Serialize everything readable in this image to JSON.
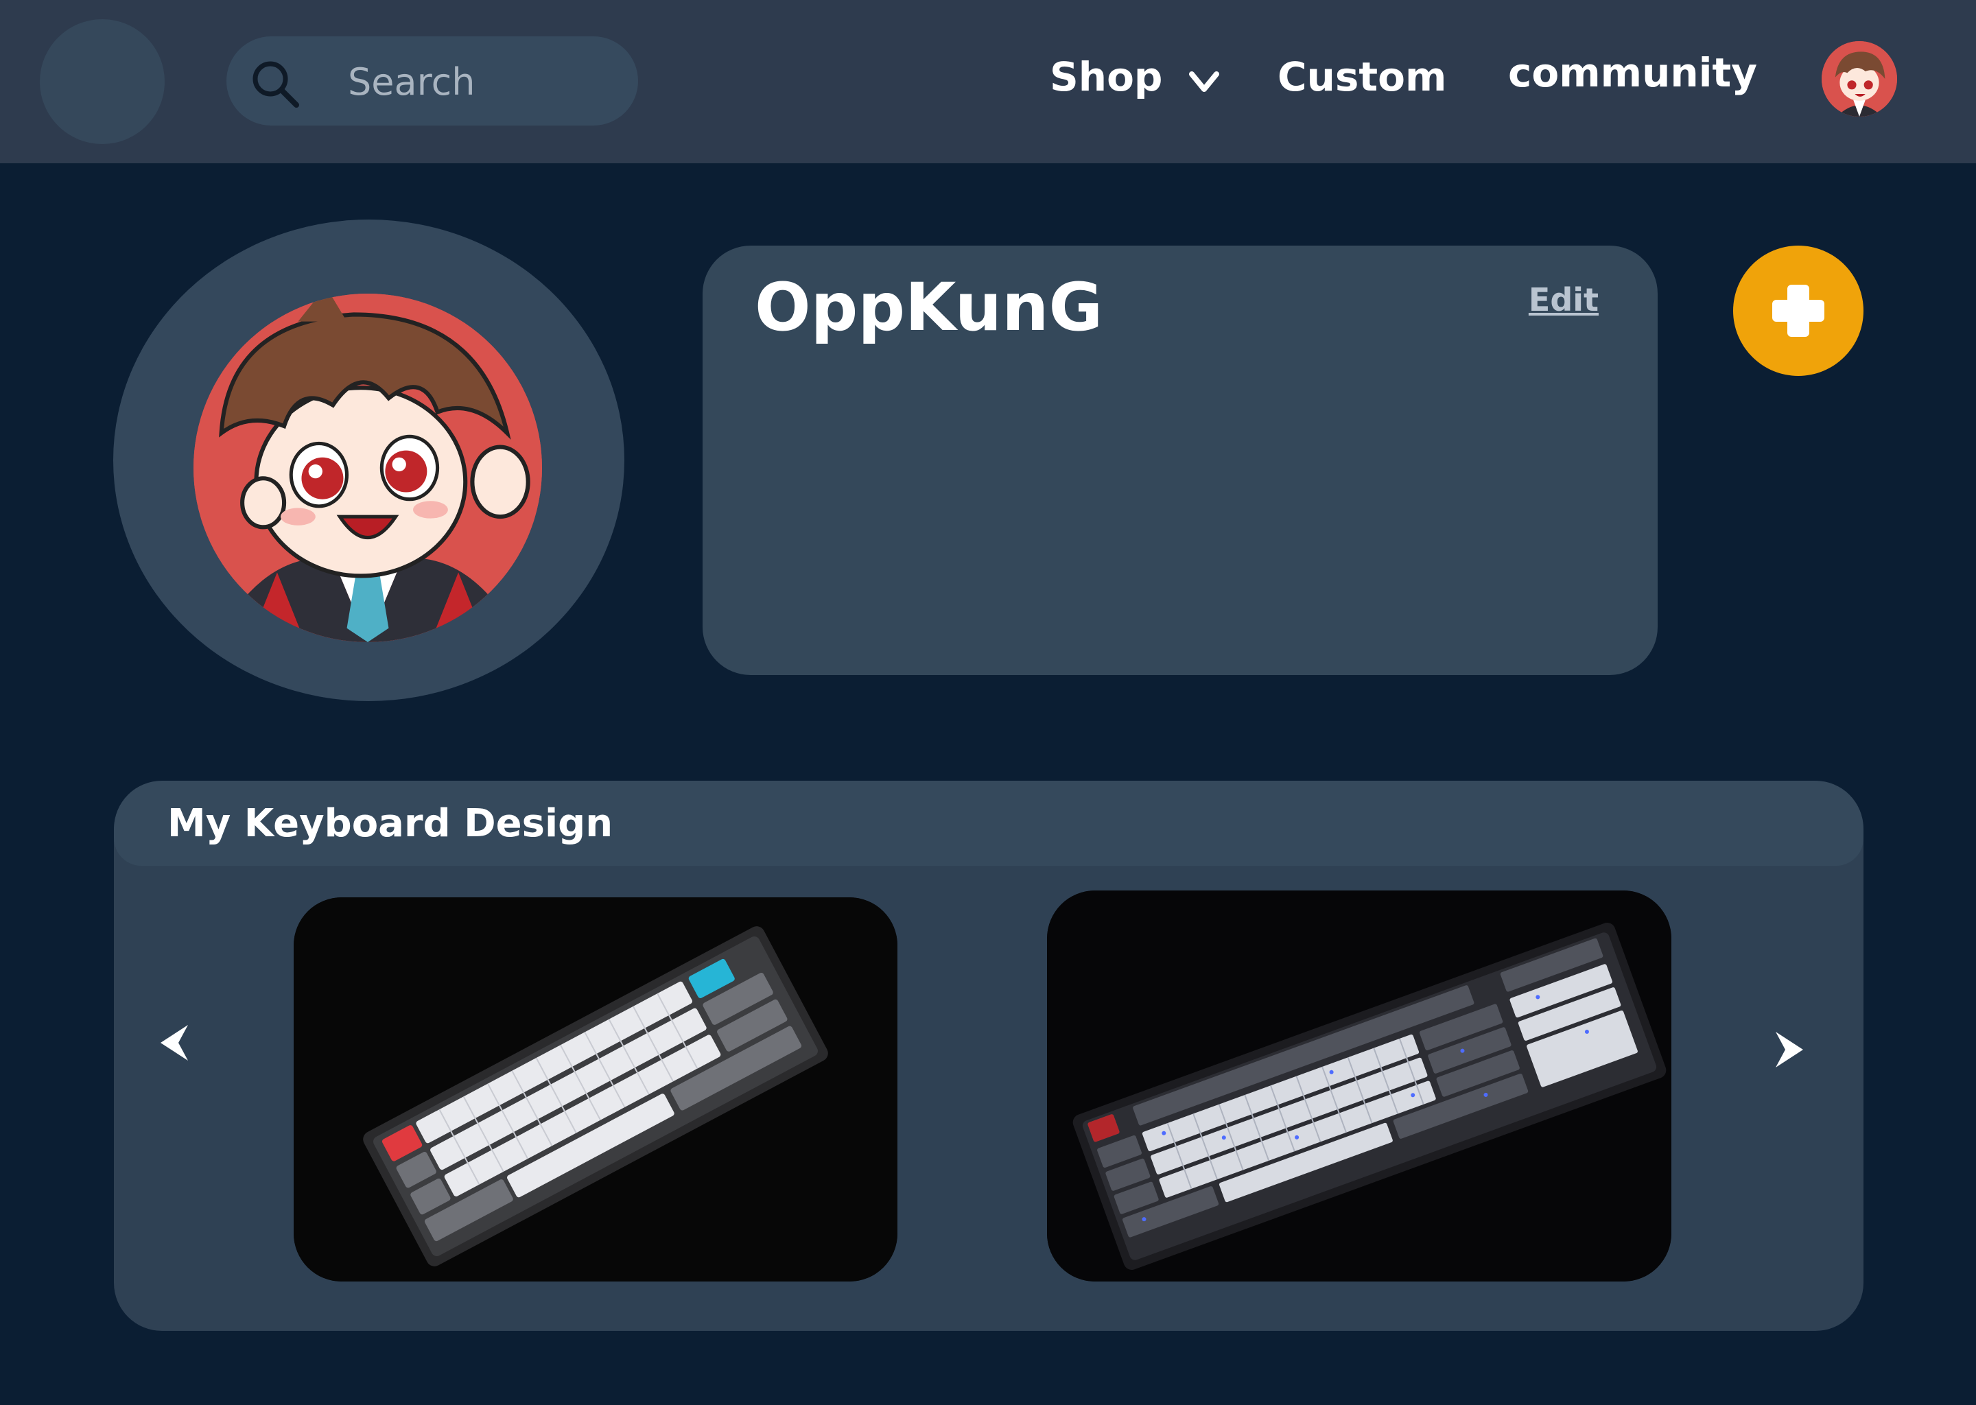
{
  "header": {
    "search": {
      "placeholder": "Search",
      "value": ""
    },
    "nav": [
      {
        "label": "Shop",
        "has_dropdown": true
      },
      {
        "label": "Custom"
      },
      {
        "label": "community"
      }
    ],
    "icons": [
      "search-icon",
      "chevron-down-icon"
    ]
  },
  "profile": {
    "username": "OppKunG",
    "edit_label": "Edit",
    "add_button_icon": "plus-icon",
    "accent_color": "#f0a30a"
  },
  "keyboards": {
    "title": "My Keyboard Design",
    "prev_icon": "arrow-left-icon",
    "next_icon": "arrow-right-icon",
    "items": [
      {
        "image": "compact-white-keyboard-photo"
      },
      {
        "image": "fullsize-grey-keyboard-photo"
      }
    ]
  },
  "colors": {
    "background": "#0b1e33",
    "topbar": "#2e3b4e",
    "panel": "#34485a"
  }
}
